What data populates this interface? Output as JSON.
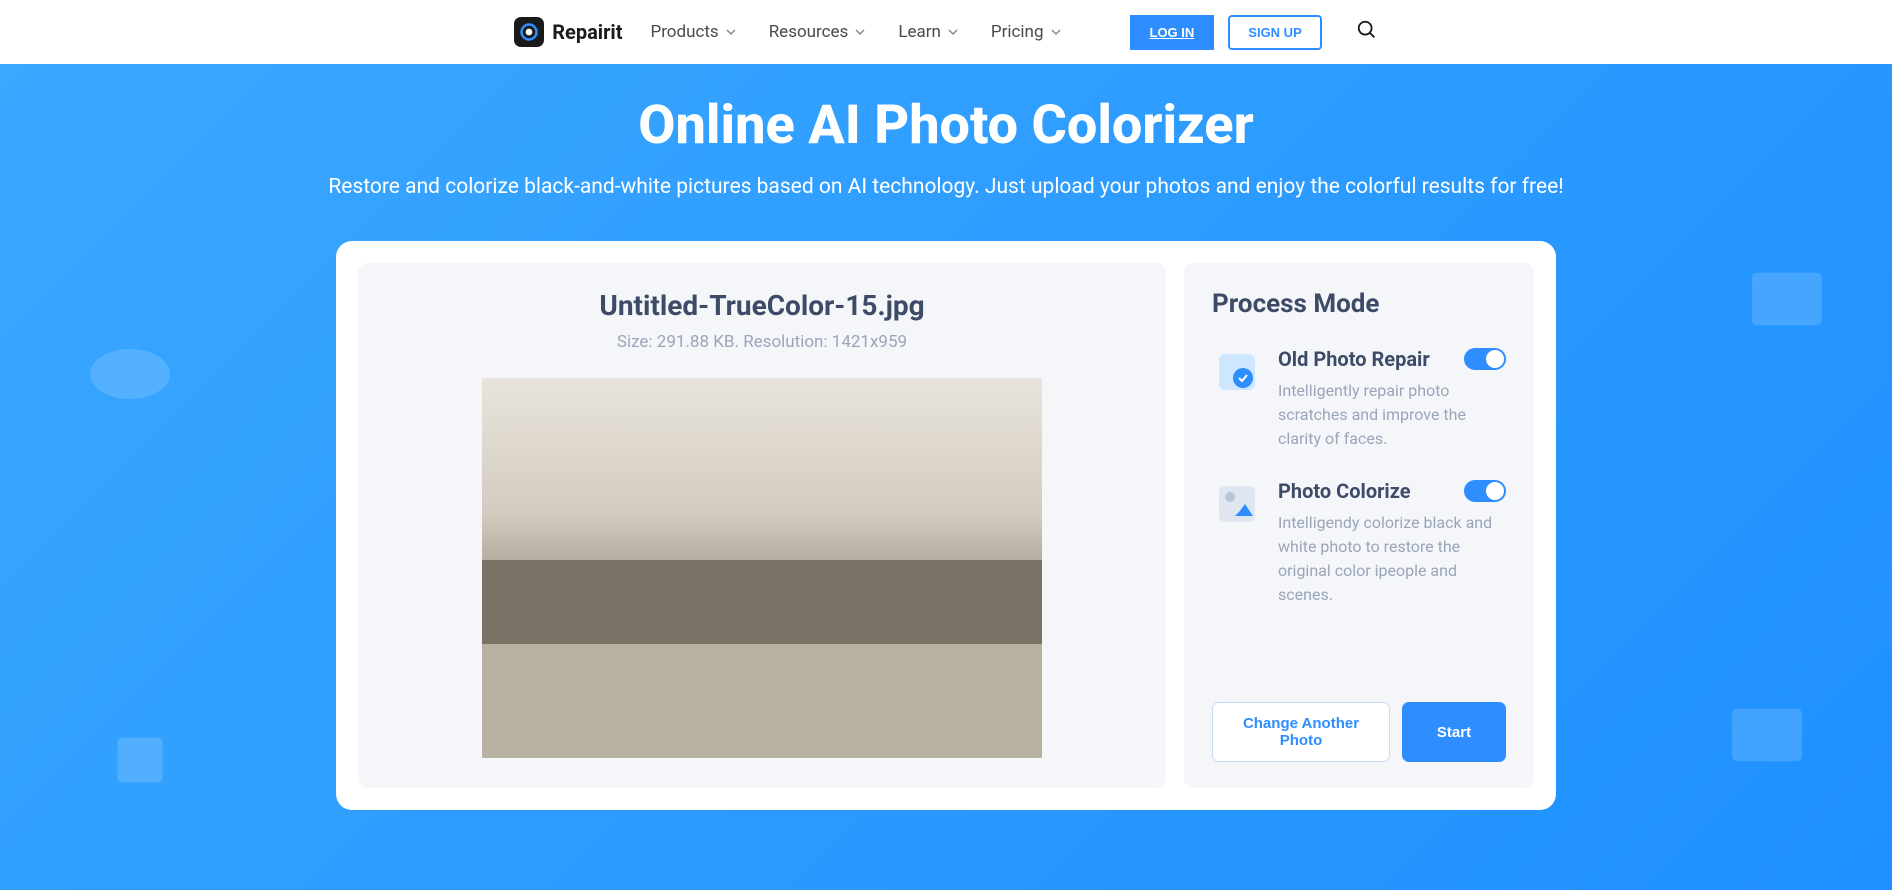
{
  "header": {
    "brand": "Repairit",
    "nav": {
      "products": "Products",
      "resources": "Resources",
      "learn": "Learn",
      "pricing": "Pricing"
    },
    "auth": {
      "login": "LOG IN",
      "signup": "SIGN UP"
    }
  },
  "hero": {
    "title": "Online AI Photo Colorizer",
    "subtitle": "Restore and colorize black-and-white pictures based on AI technology. Just upload your photos and enjoy the colorful results for free!"
  },
  "preview": {
    "filename": "Untitled-TrueColor-15.jpg",
    "info": "Size: 291.88 KB. Resolution: 1421x959"
  },
  "process": {
    "title": "Process Mode",
    "repair": {
      "label": "Old Photo Repair",
      "desc": "Intelligently repair photo scratches and improve the clarity of faces.",
      "enabled": true
    },
    "colorize": {
      "label": "Photo Colorize",
      "desc": "Intelligendy colorize black and white photo to restore the original color ipeople and scenes.",
      "enabled": true
    },
    "actions": {
      "change": "Change Another Photo",
      "start": "Start"
    }
  },
  "colors": {
    "accent": "#2e8eff"
  }
}
